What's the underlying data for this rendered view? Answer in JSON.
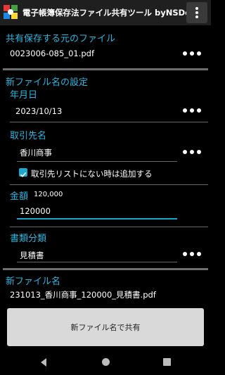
{
  "app": {
    "title": "電子帳簿保存法ファイル共有ツール byNSDev"
  },
  "source": {
    "heading": "共有保存する元のファイル",
    "filename": "0023006-085_01.pdf"
  },
  "newname_settings": {
    "heading": "新ファイル名の設定",
    "date": {
      "label": "年月日",
      "value": "2023/10/13"
    },
    "client": {
      "label": "取引先名",
      "value": "香川商事",
      "checkbox_label": "取引先リストにない時は追加する",
      "checked": true
    },
    "amount": {
      "label": "金額",
      "display": "120,000",
      "value": "120000"
    },
    "doctype": {
      "label": "書類分類",
      "value": "見積書"
    }
  },
  "result": {
    "heading": "新ファイル名",
    "filename": "231013_香川商事_120000_見積書.pdf"
  },
  "share_button": {
    "label": "新ファイル名で共有"
  },
  "colors": {
    "accent": "#29b6e0",
    "background": "#000000",
    "divider": "#6e6e6e",
    "button": "#d9d9d9"
  }
}
